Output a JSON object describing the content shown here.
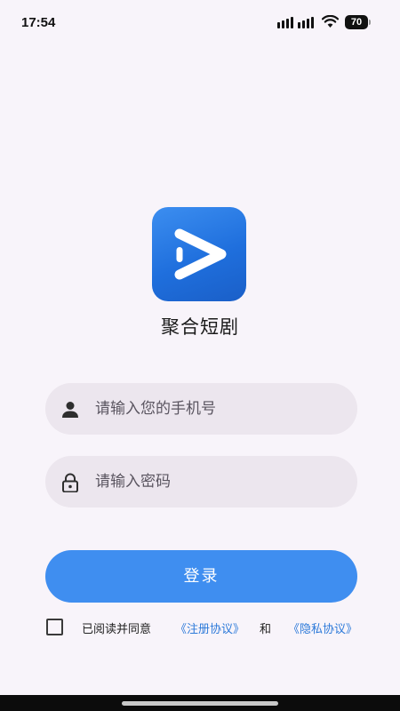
{
  "status_bar": {
    "time": "17:54",
    "battery_level": "70",
    "icons": [
      "signal-icon",
      "wifi-icon",
      "battery-icon"
    ]
  },
  "app": {
    "name": "聚合短剧",
    "logo_icon": "play-logo-icon",
    "brand_color": "#2a7ae8"
  },
  "form": {
    "phone": {
      "placeholder": "请输入您的手机号",
      "value": "",
      "icon": "user-icon"
    },
    "password": {
      "placeholder": "请输入密码",
      "value": "",
      "icon": "lock-icon"
    },
    "login_label": "登录",
    "login_color": "#3f8ef0"
  },
  "agreement": {
    "checked": false,
    "prefix": "已阅读并同意",
    "register_link": "《注册协议》",
    "and": "和",
    "privacy_link": "《隐私协议》",
    "link_color": "#2d7ad9"
  }
}
